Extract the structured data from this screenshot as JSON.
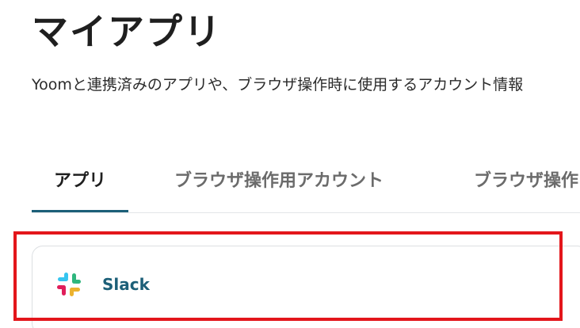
{
  "page": {
    "title": "マイアプリ",
    "description": "Yoomと連携済みのアプリや、ブラウザ操作時に使用するアカウント情報"
  },
  "tabs": [
    {
      "label": "アプリ",
      "active": true
    },
    {
      "label": "ブラウザ操作用アカウント",
      "active": false
    },
    {
      "label": "ブラウザ操作",
      "active": false
    }
  ],
  "apps": [
    {
      "name": "Slack",
      "icon": "slack-icon"
    }
  ],
  "colors": {
    "accent": "#1c5f78",
    "highlight": "#e3161b",
    "slack_blue": "#36c5f0",
    "slack_green": "#2eb67d",
    "slack_red": "#e01e5a",
    "slack_yellow": "#ecb22e"
  }
}
